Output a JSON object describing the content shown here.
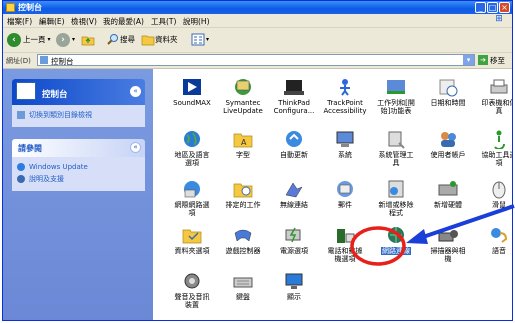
{
  "window": {
    "title": "控制台"
  },
  "menu": [
    "檔案(F)",
    "編輯(E)",
    "檢視(V)",
    "我的最愛(A)",
    "工具(T)",
    "說明(H)"
  ],
  "toolbar": {
    "back": "上一頁",
    "search": "搜尋",
    "folders": "資料夾"
  },
  "address": {
    "label": "網址(D)",
    "value": "控制台",
    "go": "移至"
  },
  "sidebar": {
    "control_panel": {
      "title": "控制台",
      "items": [
        "切換到類別目錄檢視"
      ]
    },
    "see_also": {
      "title": "請參閱",
      "items": [
        "Windows Update",
        "說明及支援"
      ]
    }
  },
  "icons": [
    {
      "label": "SoundMAX",
      "icon": "soundmax-icon"
    },
    {
      "label": "Symantec\nLiveUpdate",
      "icon": "liveupdate-icon"
    },
    {
      "label": "ThinkPad\nConfigura...",
      "icon": "thinkpad-icon"
    },
    {
      "label": "TrackPoint\nAccessibility",
      "icon": "trackpoint-icon"
    },
    {
      "label": "工作列和[開\n始]功能表",
      "icon": "taskbar-icon"
    },
    {
      "label": "日期和時間",
      "icon": "clock-icon"
    },
    {
      "label": "印表機和傳\n真",
      "icon": "printer-icon"
    },
    {
      "label": "地區及語言\n選項",
      "icon": "globe-icon"
    },
    {
      "label": "字型",
      "icon": "fonts-folder-icon"
    },
    {
      "label": "自動更新",
      "icon": "auto-update-icon"
    },
    {
      "label": "系統",
      "icon": "system-icon"
    },
    {
      "label": "系統管理工\n具",
      "icon": "admin-tools-icon"
    },
    {
      "label": "使用者帳戶",
      "icon": "users-icon"
    },
    {
      "label": "協助工具選\n項",
      "icon": "accessibility-icon"
    },
    {
      "label": "網際網路選\n項",
      "icon": "internet-options-icon"
    },
    {
      "label": "排定的工作",
      "icon": "scheduled-tasks-icon"
    },
    {
      "label": "無線連結",
      "icon": "wireless-link-icon"
    },
    {
      "label": "郵件",
      "icon": "mail-icon"
    },
    {
      "label": "新增或移除\n程式",
      "icon": "add-remove-icon"
    },
    {
      "label": "新增硬體",
      "icon": "add-hardware-icon"
    },
    {
      "label": "滑鼠",
      "icon": "mouse-icon"
    },
    {
      "label": "資料夾選項",
      "icon": "folder-options-icon"
    },
    {
      "label": "遊戲控制器",
      "icon": "game-controller-icon"
    },
    {
      "label": "電源選項",
      "icon": "power-icon"
    },
    {
      "label": "電話和數據\n機選項",
      "icon": "phone-modem-icon"
    },
    {
      "label": "網路連線",
      "icon": "network-icon"
    },
    {
      "label": "掃描器與相\n機",
      "icon": "scanner-icon"
    },
    {
      "label": "語音",
      "icon": "speech-icon"
    },
    {
      "label": "聲音及音訊\n裝置",
      "icon": "sound-icon"
    },
    {
      "label": "鍵盤",
      "icon": "keyboard-icon"
    },
    {
      "label": "顯示",
      "icon": "display-icon"
    }
  ],
  "selected_icon": "網路連線",
  "colors": {
    "titlebar": "#0a5be8",
    "sidebar": "#6f8fd8",
    "selection": "#316ac5",
    "annotation_circle": "#e8201a",
    "annotation_arrow": "#1a3fd8"
  }
}
